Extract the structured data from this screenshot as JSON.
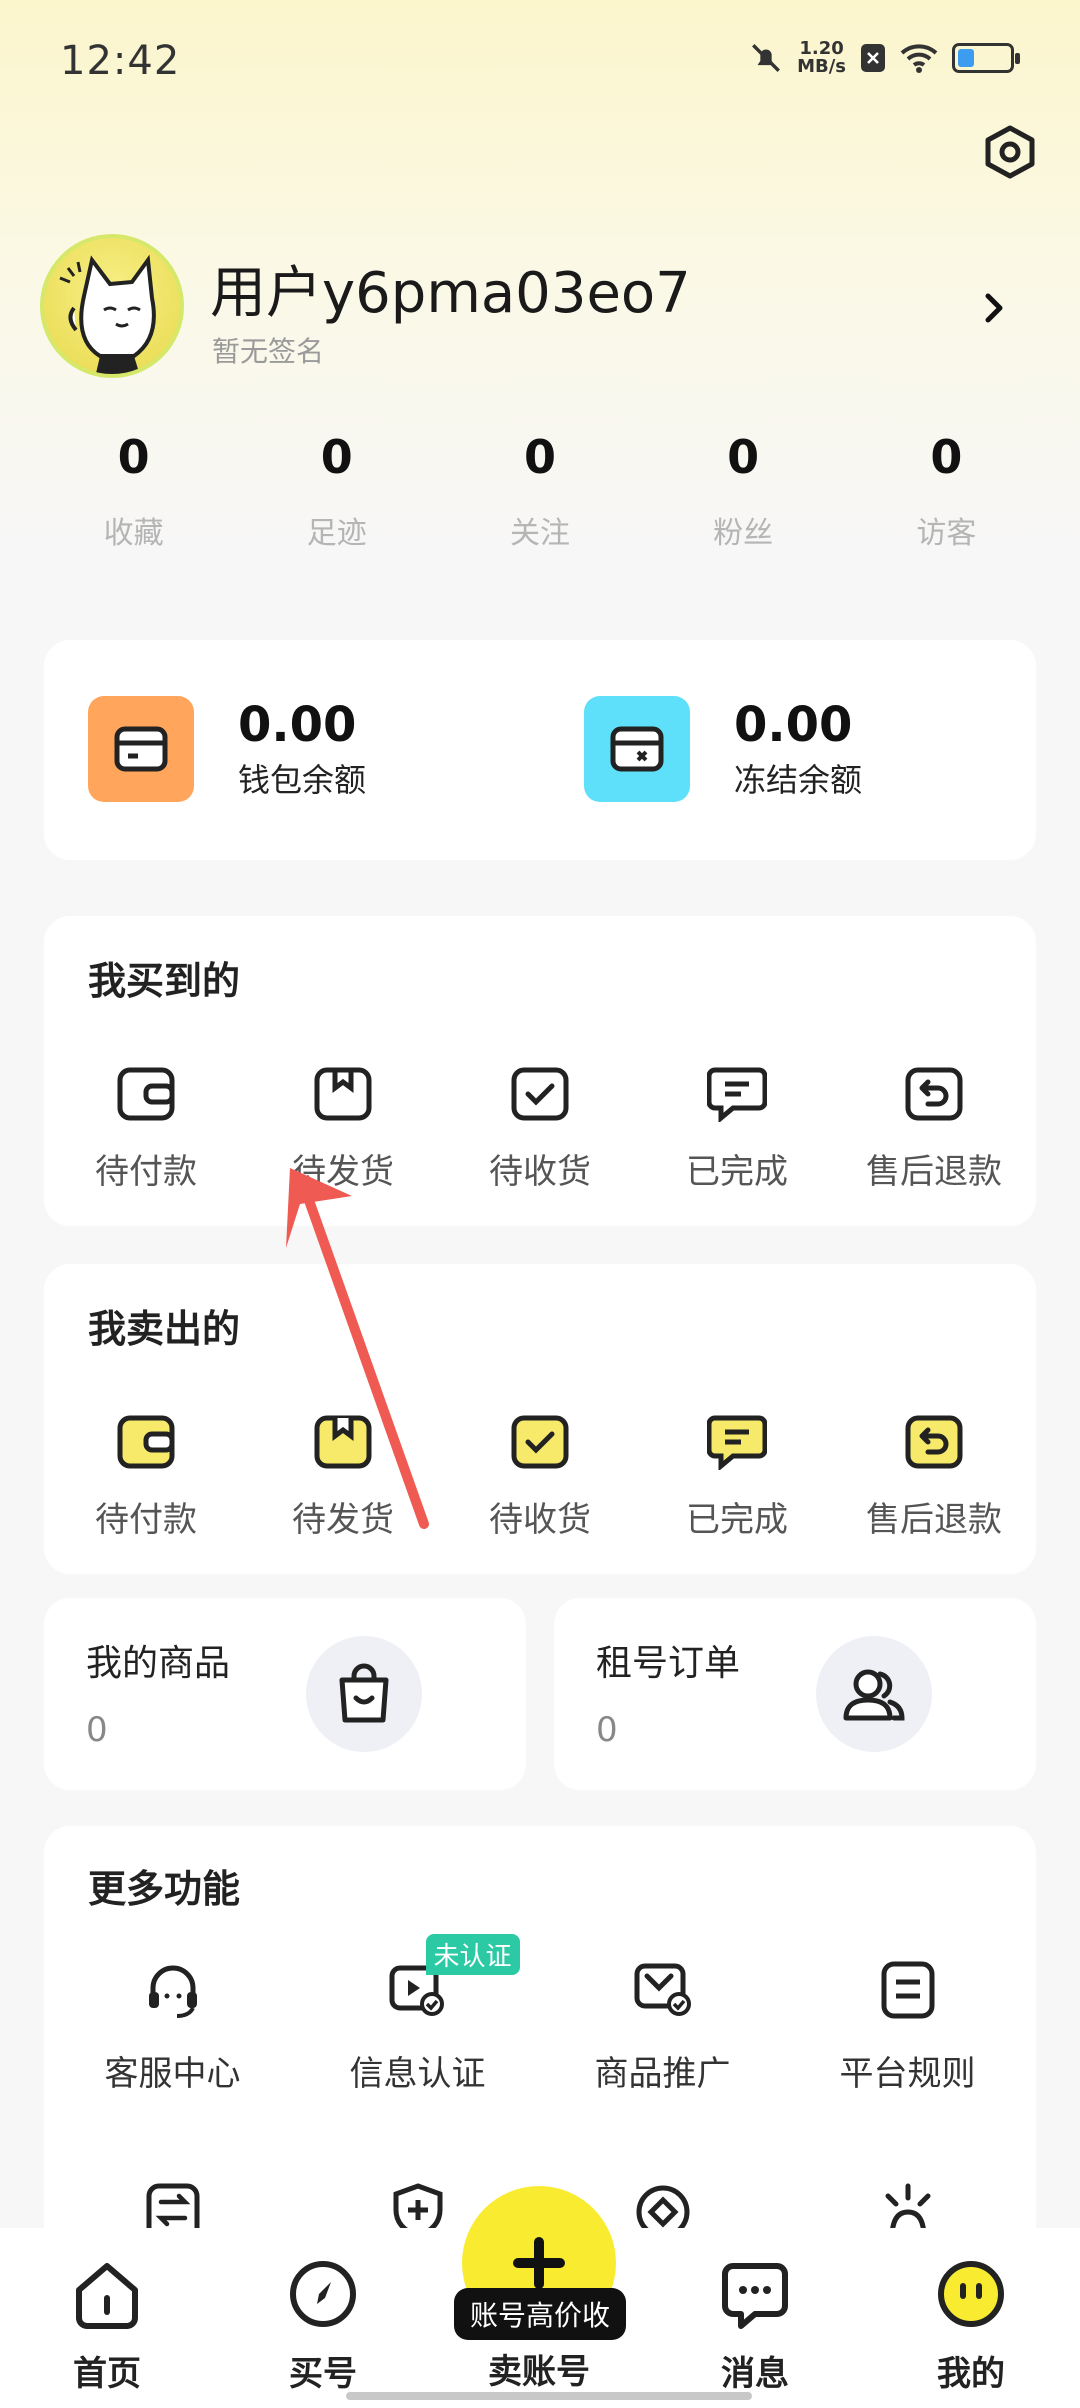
{
  "status_bar": {
    "time": "12:42",
    "net_speed_value": "1.20",
    "net_speed_unit": "MB/s"
  },
  "profile": {
    "username": "用户y6pma03eo7",
    "signature": "暂无签名"
  },
  "stats": [
    {
      "value": "0",
      "label": "收藏"
    },
    {
      "value": "0",
      "label": "足迹"
    },
    {
      "value": "0",
      "label": "关注"
    },
    {
      "value": "0",
      "label": "粉丝"
    },
    {
      "value": "0",
      "label": "访客"
    }
  ],
  "wallet": {
    "balance": {
      "amount": "0.00",
      "label": "钱包余额",
      "color": "#ffa65c"
    },
    "frozen": {
      "amount": "0.00",
      "label": "冻结余额",
      "color": "#5ee0fa"
    }
  },
  "bought": {
    "title": "我买到的",
    "items": [
      {
        "label": "待付款",
        "icon": "wallet-icon"
      },
      {
        "label": "待发货",
        "icon": "package-icon"
      },
      {
        "label": "待收货",
        "icon": "check-box-icon"
      },
      {
        "label": "已完成",
        "icon": "chat-icon"
      },
      {
        "label": "售后退款",
        "icon": "return-icon"
      }
    ]
  },
  "sold": {
    "title": "我卖出的",
    "items": [
      {
        "label": "待付款",
        "icon": "wallet-icon"
      },
      {
        "label": "待发货",
        "icon": "package-icon"
      },
      {
        "label": "待收货",
        "icon": "check-box-icon"
      },
      {
        "label": "已完成",
        "icon": "chat-icon"
      },
      {
        "label": "售后退款",
        "icon": "return-icon"
      }
    ],
    "accent": "#f7ea6a"
  },
  "my_goods": {
    "title": "我的商品",
    "count": "0"
  },
  "rent_orders": {
    "title": "租号订单",
    "count": "0"
  },
  "more": {
    "title": "更多功能",
    "items": [
      {
        "label": "客服中心",
        "icon": "headset-icon"
      },
      {
        "label": "信息认证",
        "icon": "verify-icon",
        "badge": "未认证"
      },
      {
        "label": "商品推广",
        "icon": "promote-icon"
      },
      {
        "label": "平台规则",
        "icon": "rules-icon"
      }
    ]
  },
  "tabbar": {
    "home": "首页",
    "buy": "买号",
    "sell": "卖账号",
    "sell_banner": "账号高价收",
    "messages": "消息",
    "mine": "我的"
  },
  "colors": {
    "brand_yellow": "#f9ec30",
    "annotation_arrow": "#ef5a52"
  }
}
